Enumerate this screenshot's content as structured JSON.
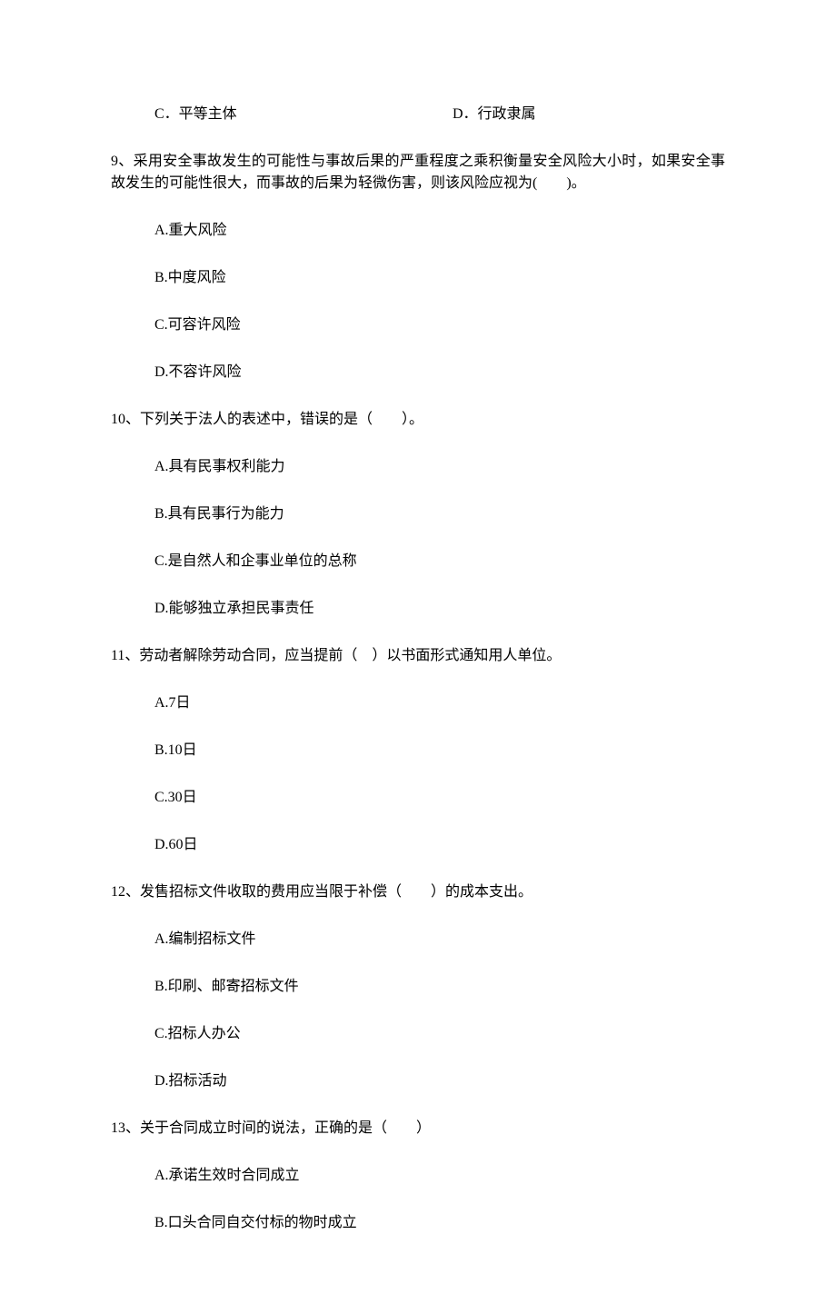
{
  "top_options": {
    "c": "C．平等主体",
    "d": "D．行政隶属"
  },
  "q9": {
    "stem": "9、采用安全事故发生的可能性与事故后果的严重程度之乘积衡量安全风险大小时，如果安全事故发生的可能性很大，而事故的后果为轻微伤害，则该风险应视为(　　)。",
    "a": "A.重大风险",
    "b": "B.中度风险",
    "c": "C.可容许风险",
    "d": "D.不容许风险"
  },
  "q10": {
    "stem": "10、下列关于法人的表述中，错误的是（　　）。",
    "a": "A.具有民事权利能力",
    "b": "B.具有民事行为能力",
    "c": "C.是自然人和企事业单位的总称",
    "d": "D.能够独立承担民事责任"
  },
  "q11": {
    "stem": "11、劳动者解除劳动合同，应当提前（　）以书面形式通知用人单位。",
    "a": "A.7日",
    "b": "B.10日",
    "c": "C.30日",
    "d": "D.60日"
  },
  "q12": {
    "stem": "12、发售招标文件收取的费用应当限于补偿（　　）的成本支出。",
    "a": "A.编制招标文件",
    "b": "B.印刷、邮寄招标文件",
    "c": "C.招标人办公",
    "d": "D.招标活动"
  },
  "q13": {
    "stem": "13、关于合同成立时间的说法，正确的是（　　）",
    "a": "A.承诺生效时合同成立",
    "b": "B.口头合同自交付标的物时成立"
  }
}
